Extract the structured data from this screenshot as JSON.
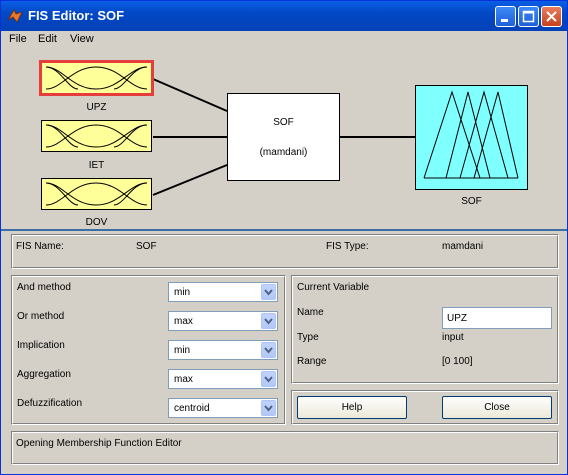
{
  "window": {
    "title": "FIS Editor: SOF"
  },
  "menu": {
    "items": [
      "File",
      "Edit",
      "View"
    ]
  },
  "diagram": {
    "inputs": [
      "UPZ",
      "IET",
      "DOV"
    ],
    "system_name": "SOF",
    "system_type": "(mamdani)",
    "output": "SOF",
    "selected_input": "UPZ",
    "colors": {
      "input_fill": "#ffff99",
      "output_fill": "#80ffff",
      "selected": "#e53c3c"
    }
  },
  "info": {
    "fis_name_label": "FIS Name:",
    "fis_name": "SOF",
    "fis_type_label": "FIS Type:",
    "fis_type": "mamdani"
  },
  "methods": [
    {
      "label": "And method",
      "value": "min"
    },
    {
      "label": "Or method",
      "value": "max"
    },
    {
      "label": "Implication",
      "value": "min"
    },
    {
      "label": "Aggregation",
      "value": "max"
    },
    {
      "label": "Defuzzification",
      "value": "centroid"
    }
  ],
  "current_variable": {
    "title": "Current Variable",
    "name_label": "Name",
    "name_value": "UPZ",
    "type_label": "Type",
    "type_value": "input",
    "range_label": "Range",
    "range_value": "[0 100]"
  },
  "buttons": {
    "help": "Help",
    "close": "Close"
  },
  "status": "Opening Membership Function Editor"
}
